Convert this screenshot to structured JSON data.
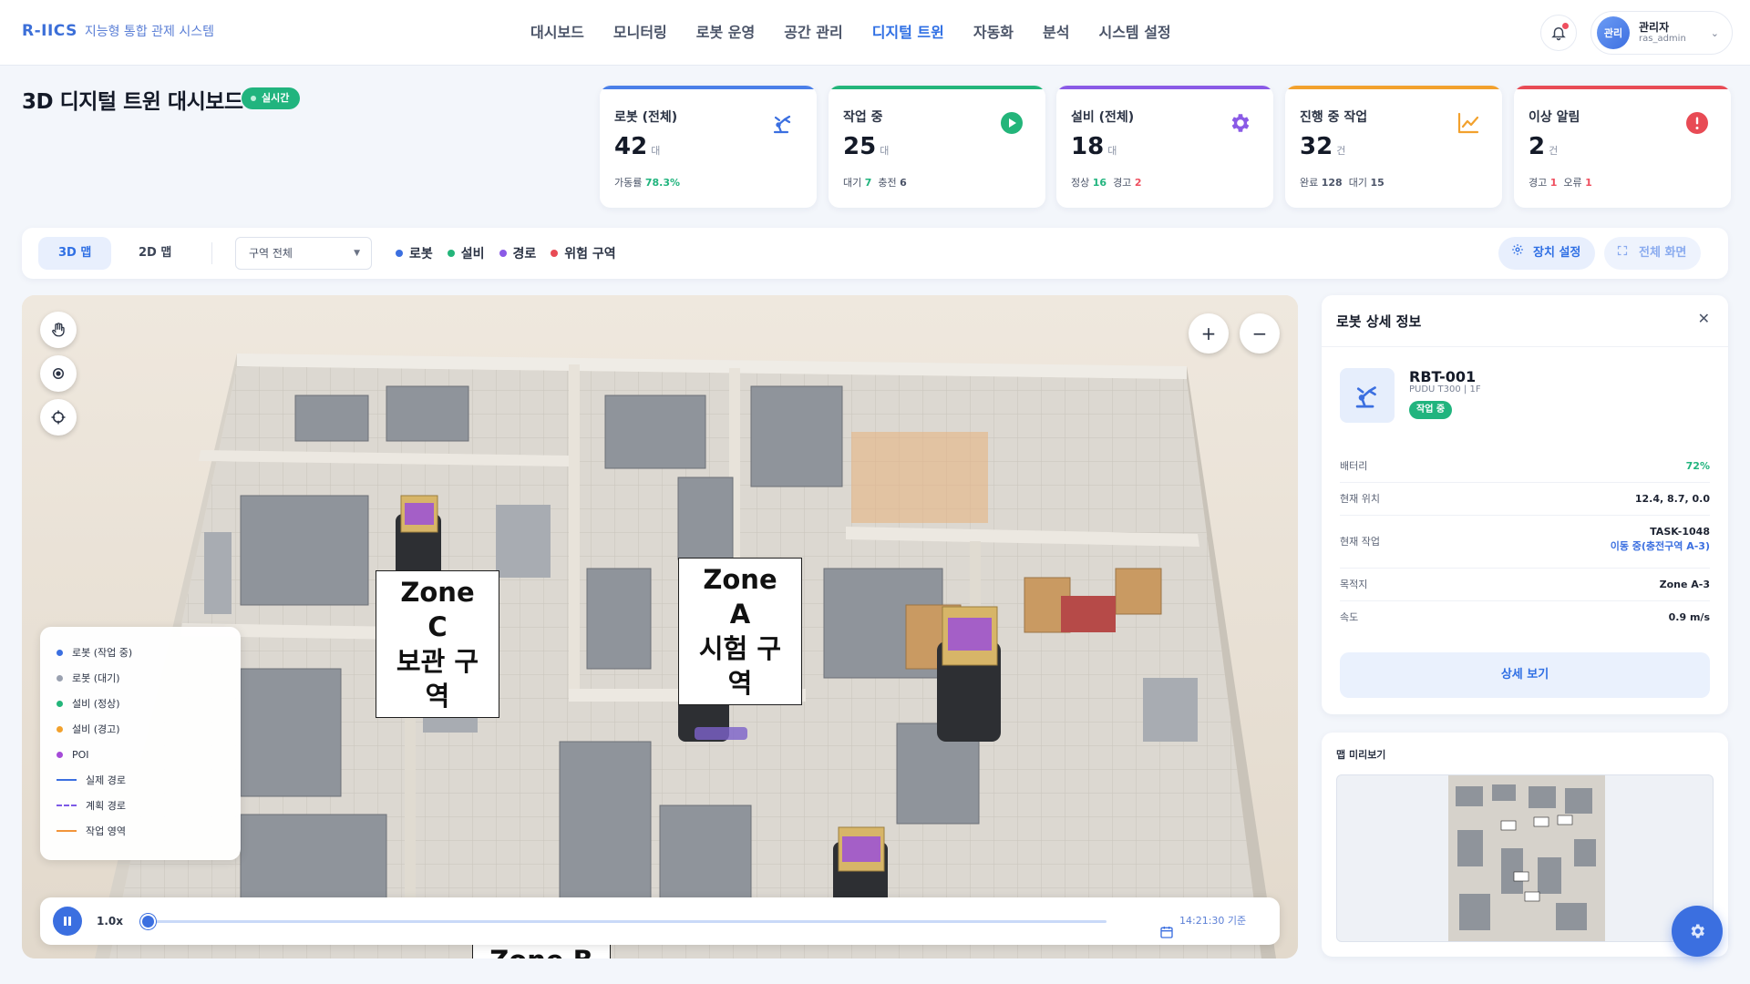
{
  "app": {
    "brand_code": "R-IICS",
    "brand_name": "지능형 통합 관제 시스템"
  },
  "nav": {
    "items": [
      {
        "label": "대시보드",
        "active": false
      },
      {
        "label": "모니터링",
        "active": false
      },
      {
        "label": "로봇 운영",
        "active": false
      },
      {
        "label": "공간 관리",
        "active": false
      },
      {
        "label": "디지털 트윈",
        "active": true
      },
      {
        "label": "자동화",
        "active": false
      },
      {
        "label": "분석",
        "active": false
      },
      {
        "label": "시스템 설정",
        "active": false
      }
    ]
  },
  "user": {
    "avatar_label": "관리",
    "name": "관리자",
    "id": "ras_admin"
  },
  "page": {
    "title": "3D 디지털 트윈 대시보드",
    "live_badge": "실시간"
  },
  "stats": [
    {
      "label": "로봇 (전체)",
      "value": "42",
      "unit": "대",
      "sub": [
        {
          "k": "가동률",
          "v": "78.3%",
          "color": "#21b47e"
        }
      ],
      "accent": "#4a7fe8",
      "icon": "robot-arm-icon"
    },
    {
      "label": "작업 중",
      "value": "25",
      "unit": "대",
      "sub": [
        {
          "k": "대기",
          "v": "7",
          "color": "#21b47e"
        },
        {
          "k": "충전",
          "v": "6",
          "color": "#1e2433"
        }
      ],
      "accent": "#23b57a",
      "icon": "play-circle-icon"
    },
    {
      "label": "설비 (전체)",
      "value": "18",
      "unit": "대",
      "sub": [
        {
          "k": "정상",
          "v": "16",
          "color": "#21b47e"
        },
        {
          "k": "경고",
          "v": "2",
          "color": "#ef4f5f"
        }
      ],
      "accent": "#8a5ae6",
      "icon": "gear-icon"
    },
    {
      "label": "진행 중 작업",
      "value": "32",
      "unit": "건",
      "sub": [
        {
          "k": "완료",
          "v": "128",
          "color": "#1e2433"
        },
        {
          "k": "대기",
          "v": "15",
          "color": "#1e2433"
        }
      ],
      "accent": "#f2a12d",
      "icon": "trend-chart-icon"
    },
    {
      "label": "이상 알림",
      "value": "2",
      "unit": "건",
      "sub": [
        {
          "k": "경고",
          "v": "1",
          "color": "#ef4f5f"
        },
        {
          "k": "오류",
          "v": "1",
          "color": "#ef4f5f"
        }
      ],
      "accent": "#e84b55",
      "icon": "alert-circle-icon"
    }
  ],
  "toolbar": {
    "tab_3d": "3D 맵",
    "tab_2d": "2D 맵",
    "zone_select": "구역 전체",
    "legend": [
      {
        "label": "로봇",
        "color": "#3b6fe0"
      },
      {
        "label": "설비",
        "color": "#23b57a"
      },
      {
        "label": "경로",
        "color": "#8a5ae6"
      },
      {
        "label": "위험 구역",
        "color": "#e84b55"
      }
    ],
    "device_settings": "장치 설정",
    "fullscreen": "전체 화면"
  },
  "map": {
    "zone_labels": [
      {
        "line1": "Zone C",
        "line2": "보관 구역"
      },
      {
        "line1": "Zone A",
        "line2": "시험 구역"
      },
      {
        "line1": "Zone B",
        "line2": ""
      }
    ],
    "legend": [
      {
        "type": "dot",
        "label": "로봇 (작업 중)",
        "color": "#3b6fe0"
      },
      {
        "type": "dot",
        "label": "로봇 (대기)",
        "color": "#9aa1b0"
      },
      {
        "type": "dot",
        "label": "설비 (정상)",
        "color": "#23b57a"
      },
      {
        "type": "dot",
        "label": "설비 (경고)",
        "color": "#f2a12d"
      },
      {
        "type": "dot",
        "label": "POI",
        "color": "#a54bd8"
      },
      {
        "type": "line",
        "label": "실제 경로",
        "color": "#3b6fe0"
      },
      {
        "type": "dashed",
        "label": "계획 경로",
        "color": "#7d5ae6"
      },
      {
        "type": "line",
        "label": "작업 영역",
        "color": "#f2953a"
      }
    ],
    "playback": {
      "speed": "1.0x",
      "progress": 0.0,
      "time": "14:21:30 기준"
    }
  },
  "detail": {
    "title": "로봇 상세 정보",
    "robot_id": "RBT-001",
    "robot_model": "PUDU T300 | 1F",
    "status": "작업 중",
    "rows": [
      {
        "k": "배터리",
        "v": "72%",
        "v_color": "#21b47e"
      },
      {
        "k": "현재 위치",
        "v": "12.4, 8.7, 0.0"
      },
      {
        "k": "현재 작업",
        "v": "TASK-1048",
        "v2": "이동 중(충전구역 A-3)"
      },
      {
        "k": "목적지",
        "v": "Zone A-3"
      },
      {
        "k": "속도",
        "v": "0.9 m/s"
      }
    ],
    "detail_button": "상세 보기"
  },
  "minimap": {
    "title": "맵 미리보기"
  }
}
